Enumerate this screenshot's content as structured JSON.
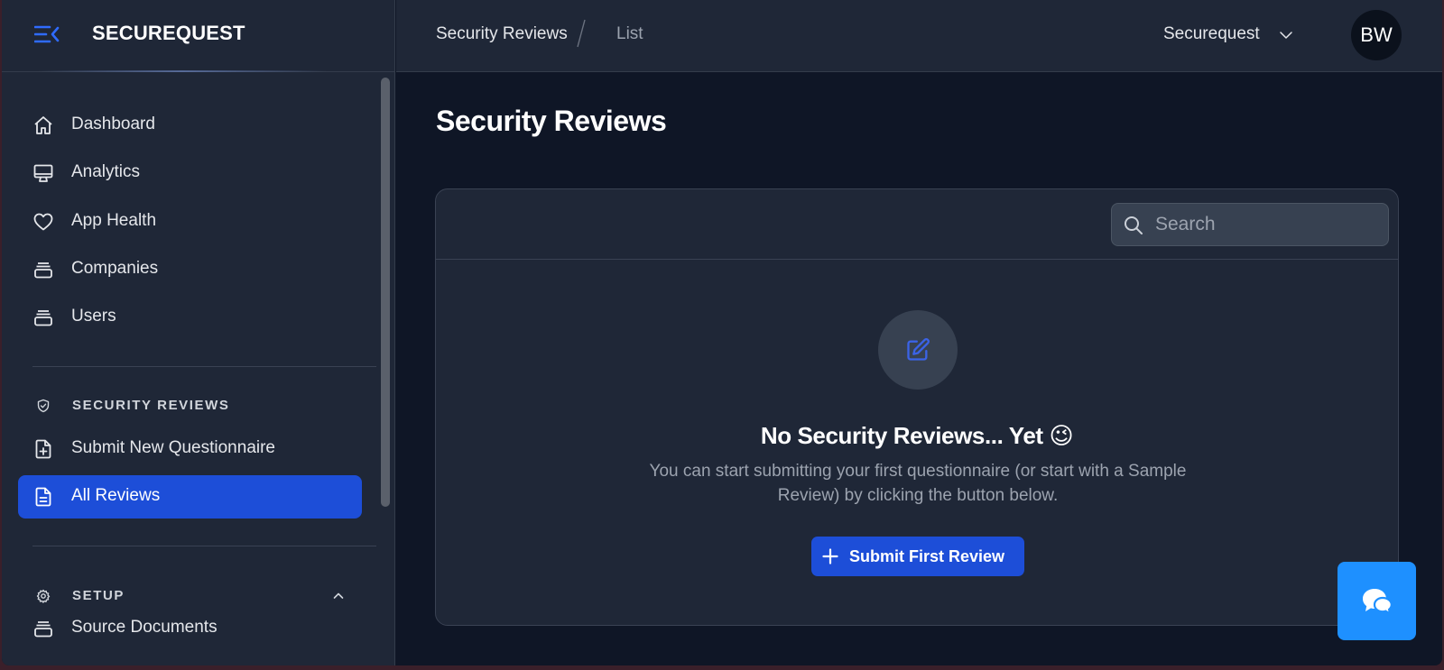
{
  "brand": {
    "name": "SECUREQUEST",
    "menu_icon": "sidebar-collapse-icon"
  },
  "sidebar": {
    "main_items": [
      {
        "label": "Dashboard",
        "icon": "home-icon"
      },
      {
        "label": "Analytics",
        "icon": "monitor-icon"
      },
      {
        "label": "App Health",
        "icon": "heart-icon"
      },
      {
        "label": "Companies",
        "icon": "stack-icon"
      },
      {
        "label": "Users",
        "icon": "stack-icon"
      }
    ],
    "sections": [
      {
        "title": "SECURITY REVIEWS",
        "icon": "shield-icon",
        "items": [
          {
            "label": "Submit New Questionnaire",
            "icon": "file-plus-icon"
          },
          {
            "label": "All Reviews",
            "icon": "file-text-icon",
            "active": true
          }
        ]
      },
      {
        "title": "SETUP",
        "icon": "gear-icon",
        "expanded": true,
        "items": [
          {
            "label": "Source Documents",
            "icon": "stack-icon"
          }
        ]
      }
    ]
  },
  "topbar": {
    "breadcrumb": [
      "Security Reviews",
      "List"
    ],
    "org_select": {
      "value": "Securequest"
    },
    "avatar_initials": "BW"
  },
  "main": {
    "title": "Security Reviews",
    "search": {
      "placeholder": "Search",
      "value": ""
    },
    "empty_state": {
      "icon": "edit-icon",
      "title": "No Security Reviews... Yet 😉",
      "description": "You can start submitting your first questionnaire (or start with a Sample Review) by clicking the button below.",
      "button_label": "Submit First Review"
    }
  },
  "colors": {
    "accent": "#1d4ed8",
    "sidebar_bg": "#1f2737",
    "page_bg": "#0f1626",
    "chat_fab": "#1e90ff"
  }
}
